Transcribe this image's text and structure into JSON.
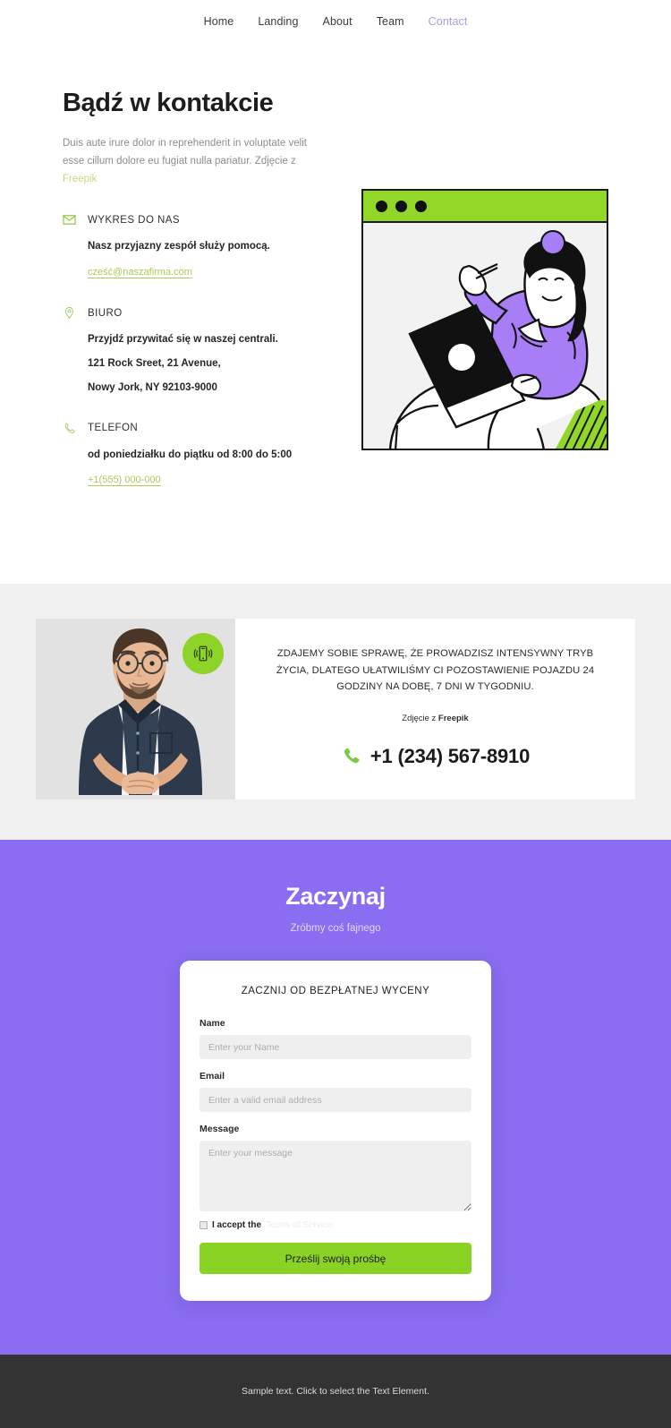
{
  "nav": {
    "items": [
      {
        "label": "Home",
        "active": false
      },
      {
        "label": "Landing",
        "active": false
      },
      {
        "label": "About",
        "active": false
      },
      {
        "label": "Team",
        "active": false
      },
      {
        "label": "Contact",
        "active": true
      }
    ]
  },
  "hero": {
    "title": "Bądź w kontakcie",
    "description": "Duis aute irure dolor in reprehenderit in voluptate velit esse cillum dolore eu fugiat nulla pariatur. Zdjęcie z ",
    "credit_link": "Freepik",
    "blocks": [
      {
        "icon": "envelope-icon",
        "label": "WYKRES DO NAS",
        "lines": [
          "Nasz przyjazny zespół służy pomocą."
        ],
        "link": "cześć@naszafirma.com"
      },
      {
        "icon": "map-pin-icon",
        "label": "BIURO",
        "lines": [
          "Przyjdź przywitać się w naszej centrali.",
          "121 Rock Sreet, 21 Avenue,",
          "Nowy Jork, NY 92103-9000"
        ],
        "link": ""
      },
      {
        "icon": "phone-icon",
        "label": "TELEFON",
        "lines": [
          "od poniedziałku do piątku od 8:00 do 5:00"
        ],
        "link": "+1(555) 000-000"
      }
    ],
    "illustration": {
      "name": "person-with-laptop-illustration",
      "window_dots": 3,
      "bar_color": "#92d727"
    }
  },
  "callout": {
    "photo_alt": "man-in-dark-shirt-photo",
    "badge_icon": "vibrating-phone-icon",
    "headline": "ZDAJEMY SOBIE SPRAWĘ, ŻE PROWADZISZ INTENSYWNY TRYB ŻYCIA, DLATEGO UŁATWILIŚMY CI POZOSTAWIENIE POJAZDU 24 GODZINY NA DOBĘ, 7 DNI W TYGODNIU.",
    "credit_prefix": "Zdjęcie z ",
    "credit_source": "Freepik",
    "phone": "+1 (234) 567-8910",
    "phone_icon": "phone-icon"
  },
  "cta": {
    "title": "Zaczynaj",
    "subtitle": "Zróbmy coś fajnego",
    "form": {
      "title": "ZACZNIJ OD BEZPŁATNEJ WYCENY",
      "name_label": "Name",
      "name_placeholder": "Enter your Name",
      "name_value": "",
      "email_label": "Email",
      "email_placeholder": "Enter a valid email address",
      "email_value": "",
      "message_label": "Message",
      "message_placeholder": "Enter your message",
      "message_value": "",
      "accept_text": "I accept the",
      "terms_label": "Terms of Service",
      "submit_label": "Prześlij swoją prośbę"
    }
  },
  "footer": {
    "text": "Sample text. Click to select the Text Element."
  },
  "colors": {
    "accent_green": "#8ad324",
    "accent_purple": "#8a6df0",
    "link_green": "#a9cc54",
    "gray_section": "#f0f0f0",
    "footer_dark": "#333333"
  }
}
